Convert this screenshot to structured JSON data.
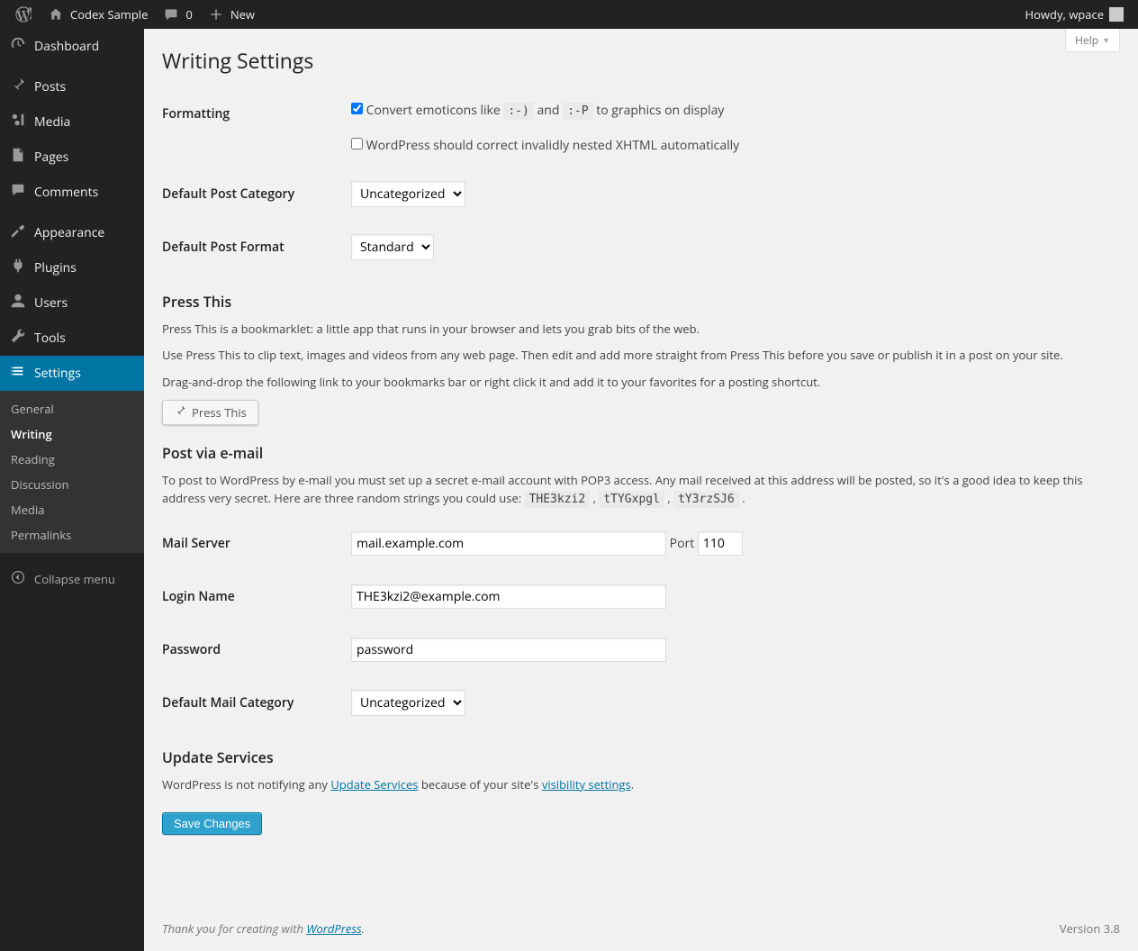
{
  "adminbar": {
    "site_name": "Codex Sample",
    "comments_count": "0",
    "new_label": "New",
    "howdy": "Howdy, wpace"
  },
  "menu": {
    "dashboard": "Dashboard",
    "posts": "Posts",
    "media": "Media",
    "pages": "Pages",
    "comments": "Comments",
    "appearance": "Appearance",
    "plugins": "Plugins",
    "users": "Users",
    "tools": "Tools",
    "settings": "Settings",
    "collapse": "Collapse menu"
  },
  "submenu": {
    "general": "General",
    "writing": "Writing",
    "reading": "Reading",
    "discussion": "Discussion",
    "media": "Media",
    "permalinks": "Permalinks"
  },
  "help_label": "Help",
  "page_title": "Writing Settings",
  "formatting": {
    "label": "Formatting",
    "emoticons_pre": "Convert emoticons like ",
    "code1": ":-)",
    "mid": " and ",
    "code2": ":-P",
    "emoticons_post": " to graphics on display",
    "xhtml": "WordPress should correct invalidly nested XHTML automatically"
  },
  "default_category": {
    "label": "Default Post Category",
    "value": "Uncategorized"
  },
  "default_format": {
    "label": "Default Post Format",
    "value": "Standard"
  },
  "pressthis": {
    "title": "Press This",
    "p1": "Press This is a bookmarklet: a little app that runs in your browser and lets you grab bits of the web.",
    "p2": "Use Press This to clip text, images and videos from any web page. Then edit and add more straight from Press This before you save or publish it in a post on your site.",
    "p3": "Drag-and-drop the following link to your bookmarks bar or right click it and add it to your favorites for a posting shortcut.",
    "button": "Press This"
  },
  "postemail": {
    "title": "Post via e-mail",
    "desc_pre": "To post to WordPress by e-mail you must set up a secret e-mail account with POP3 access. Any mail received at this address will be posted, so it's a good idea to keep this address very secret. Here are three random strings you could use: ",
    "r1": "THE3kzi2",
    "r2": "tTYGxpgl",
    "r3": "tY3rzSJ6",
    "mail_server_label": "Mail Server",
    "mail_server_value": "mail.example.com",
    "port_label": "Port",
    "port_value": "110",
    "login_label": "Login Name",
    "login_value": "THE3kzi2@example.com",
    "password_label": "Password",
    "password_value": "password",
    "default_mail_cat_label": "Default Mail Category",
    "default_mail_cat_value": "Uncategorized"
  },
  "update_services": {
    "title": "Update Services",
    "pre": "WordPress is not notifying any ",
    "link1": "Update Services",
    "mid": " because of your site's ",
    "link2": "visibility settings",
    "post": "."
  },
  "save_button": "Save Changes",
  "footer": {
    "thankyou_pre": "Thank you for creating with ",
    "wp": "WordPress",
    "thankyou_post": ".",
    "version": "Version 3.8"
  }
}
